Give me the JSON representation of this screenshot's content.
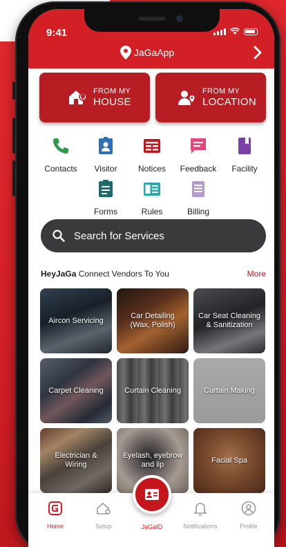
{
  "status_bar": {
    "time": "9:41"
  },
  "header": {
    "title": "JaGaApp"
  },
  "location_buttons": [
    {
      "small": "FROM MY",
      "big": "HOUSE",
      "icon": "house-icon"
    },
    {
      "small": "FROM MY",
      "big": "LOCATION",
      "icon": "person-pin-icon"
    }
  ],
  "quick_links": [
    {
      "label": "Contacts",
      "icon": "phone-icon",
      "color": "#2e9a4a"
    },
    {
      "label": "Visitor",
      "icon": "badge-icon",
      "color": "#2f6fb5"
    },
    {
      "label": "Notices",
      "icon": "notice-icon",
      "color": "#c4161c"
    },
    {
      "label": "Feedback",
      "icon": "chat-icon",
      "color": "#e0487a"
    },
    {
      "label": "Facility",
      "icon": "book-icon",
      "color": "#7b3fa8"
    },
    {
      "label": "Forms",
      "icon": "clipboard-icon",
      "color": "#1d6b6b"
    },
    {
      "label": "Rules",
      "icon": "rules-icon",
      "color": "#2aa8b0"
    },
    {
      "label": "Billing",
      "icon": "billing-icon",
      "color": "#b49ad0"
    }
  ],
  "search": {
    "placeholder": "Search for Services"
  },
  "section": {
    "brand": "HeyJaGa",
    "subtitle": " Connect Vendors To You",
    "more": "More"
  },
  "services": [
    {
      "label": "Aircon Servicing"
    },
    {
      "label": "Car Detailing (Wax, Polish)"
    },
    {
      "label": "Car Seat Cleaning & Sanitization"
    },
    {
      "label": "Carpet Cleaning"
    },
    {
      "label": "Curtain Cleaning"
    },
    {
      "label": "Curtain Making"
    },
    {
      "label": "Electrician & Wiring"
    },
    {
      "label": "Eyelash, eyebrow and lip"
    },
    {
      "label": "Facial Spa"
    }
  ],
  "tabs": [
    {
      "label": "Home",
      "active": true
    },
    {
      "label": "Setup"
    },
    {
      "label": "JaGaID"
    },
    {
      "label": "Notifications"
    },
    {
      "label": "Profile"
    }
  ],
  "colors": {
    "brand_red": "#d32027",
    "dark_red": "#b81d24",
    "search_bg": "#3a3a3c"
  }
}
